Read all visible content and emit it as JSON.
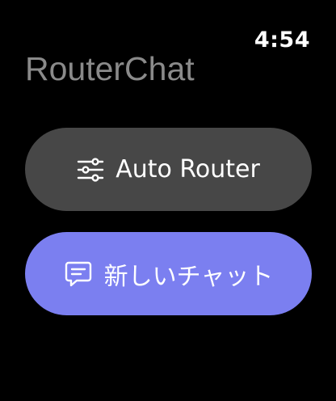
{
  "status": {
    "time": "4:54"
  },
  "app": {
    "title": "RouterChat"
  },
  "buttons": {
    "auto_router": {
      "label": "Auto Router",
      "icon": "sliders-icon",
      "color": "#474747"
    },
    "new_chat": {
      "label": "新しいチャット",
      "icon": "chat-bubble-icon",
      "color": "#7b7ff0"
    }
  }
}
